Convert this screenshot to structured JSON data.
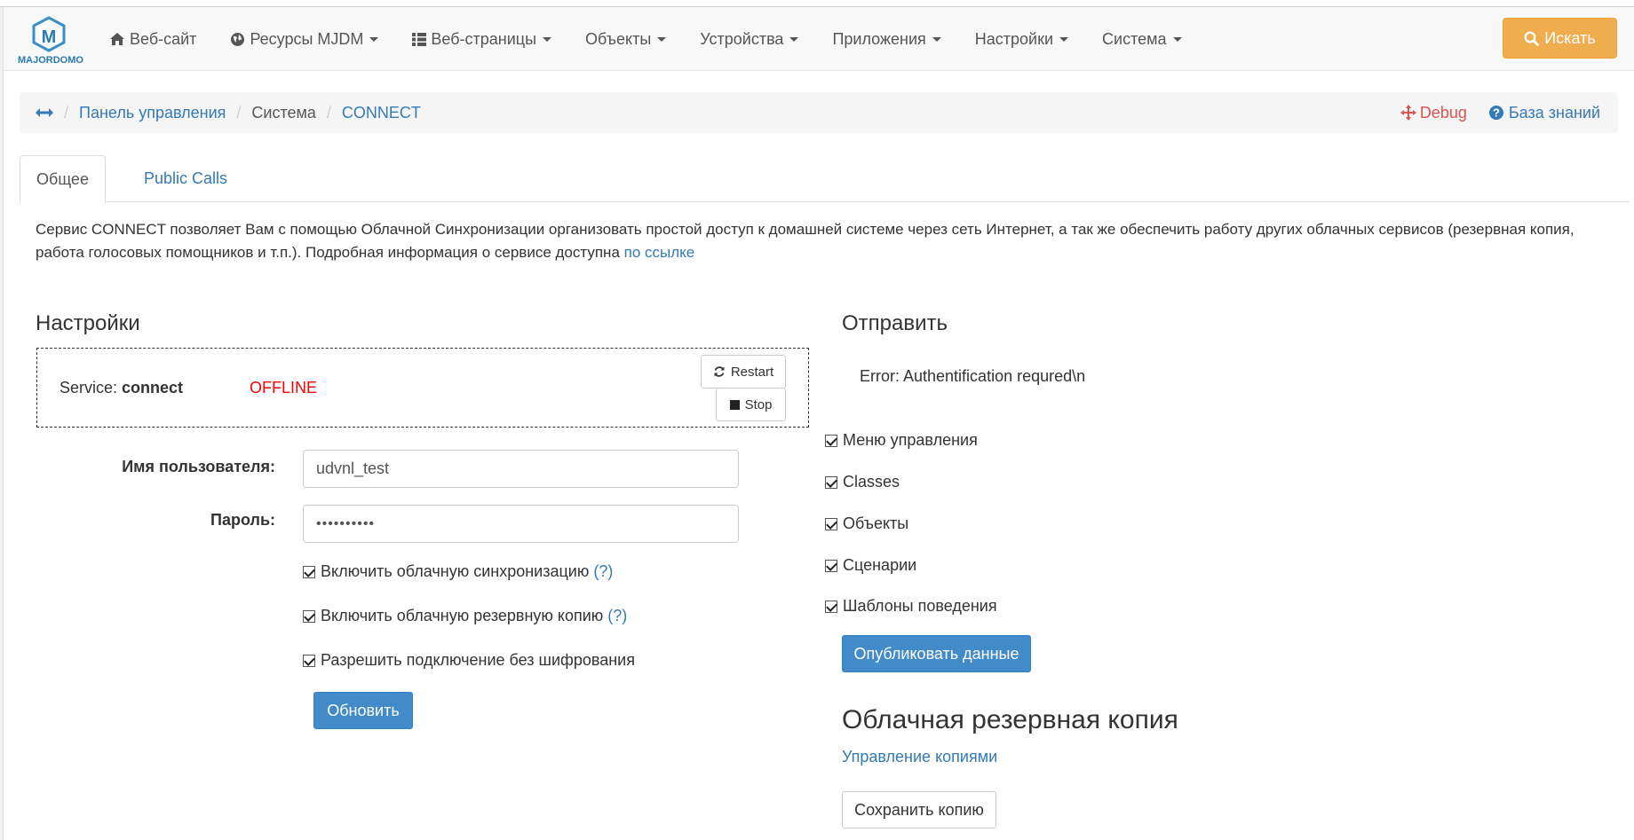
{
  "brand": {
    "name": "MAJORDOMO",
    "letter": "M"
  },
  "nav": {
    "items": [
      {
        "label": "Веб-сайт",
        "icon": "home-icon",
        "dropdown": false
      },
      {
        "label": "Ресурсы MJDM",
        "icon": "globe-icon",
        "dropdown": true
      },
      {
        "label": "Веб-страницы",
        "icon": "list-icon",
        "dropdown": true
      },
      {
        "label": "Объекты",
        "icon": "",
        "dropdown": true
      },
      {
        "label": "Устройства",
        "icon": "",
        "dropdown": true
      },
      {
        "label": "Приложения",
        "icon": "",
        "dropdown": true
      },
      {
        "label": "Настройки",
        "icon": "",
        "dropdown": true
      },
      {
        "label": "Система",
        "icon": "",
        "dropdown": true
      }
    ],
    "search_label": "Искать"
  },
  "breadcrumb": {
    "items": [
      "Панель управления",
      "Система",
      "CONNECT"
    ],
    "debug_label": "Debug",
    "kb_label": "База знаний"
  },
  "tabs": [
    {
      "label": "Общее",
      "active": true
    },
    {
      "label": "Public Calls",
      "active": false
    }
  ],
  "intro": {
    "text": "Сервис CONNECT позволяет Вам с помощью Облачной Синхронизации организовать простой доступ к домашней системе через сеть Интернет, а так же обеспечить работу других облачных сервисов (резервная копия, работа голосовых помощников и т.п.). Подробная информация о сервисе доступна ",
    "link": "по ссылке"
  },
  "settings": {
    "title": "Настройки",
    "service_prefix": "Service: ",
    "service_name": "connect",
    "status": "OFFLINE",
    "restart_label": "Restart",
    "stop_label": "Stop",
    "username_label": "Имя пользователя:",
    "username_value": "udvnl_test",
    "password_label": "Пароль:",
    "password_value": "••••••••••",
    "checks": [
      {
        "label": "Включить облачную синхронизацию",
        "help": "(?)",
        "checked": true
      },
      {
        "label": "Включить облачную резервную копию",
        "help": "(?)",
        "checked": true
      },
      {
        "label": "Разрешить подключение без шифрования",
        "help": "",
        "checked": true
      }
    ],
    "update_label": "Обновить"
  },
  "send": {
    "title": "Отправить",
    "error": "Error: Authentification requred\\n",
    "checks": [
      {
        "label": "Меню управления",
        "checked": true
      },
      {
        "label": "Classes",
        "checked": true
      },
      {
        "label": "Объекты",
        "checked": true
      },
      {
        "label": "Сценарии",
        "checked": true
      },
      {
        "label": "Шаблоны поведения",
        "checked": true
      }
    ],
    "publish_label": "Опубликовать данные"
  },
  "backup": {
    "title": "Облачная резервная копия",
    "manage_link": "Управление копиями",
    "save_label": "Сохранить копию"
  },
  "colors": {
    "link": "#337ab7",
    "primary": "#428bca",
    "warning": "#f0ad4e",
    "danger": "#d9534f",
    "offline": "#ff0000"
  }
}
